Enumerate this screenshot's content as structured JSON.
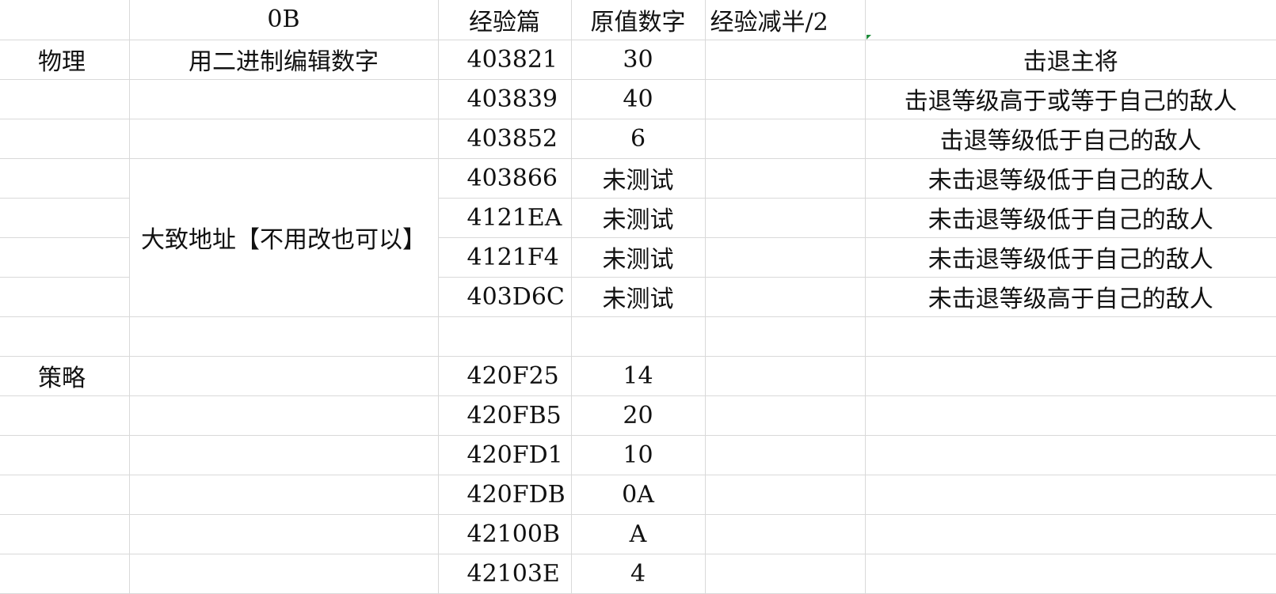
{
  "header": [
    "",
    "0B",
    "经验篇",
    "原值数字",
    "经验减半/2",
    ""
  ],
  "categories": {
    "physical": "物理",
    "strategy": "策略"
  },
  "notes": {
    "binary_edit": "用二进制编辑数字",
    "approx_address": "大致地址【不用改也可以】"
  },
  "rows_physical": [
    {
      "address": "403821",
      "value": "30",
      "desc": "击退主将"
    },
    {
      "address": "403839",
      "value": "40",
      "desc": "击退等级高于或等于自己的敌人"
    },
    {
      "address": "403852",
      "value": "6",
      "desc": "击退等级低于自己的敌人"
    },
    {
      "address": "403866",
      "value": "未测试",
      "desc": "未击退等级低于自己的敌人"
    },
    {
      "address": "4121EA",
      "value": "未测试",
      "desc": "未击退等级低于自己的敌人"
    },
    {
      "address": "4121F4",
      "value": "未测试",
      "desc": "未击退等级低于自己的敌人"
    },
    {
      "address": "403D6C",
      "value": "未测试",
      "desc": "未击退等级高于自己的敌人"
    }
  ],
  "rows_strategy": [
    {
      "address": "420F25",
      "value": "14"
    },
    {
      "address": "420FB5",
      "value": "20"
    },
    {
      "address": "420FD1",
      "value": "10"
    },
    {
      "address": "420FDB",
      "value": "0A"
    },
    {
      "address": "42100B",
      "value": "A"
    },
    {
      "address": "42103E",
      "value": "4"
    }
  ]
}
